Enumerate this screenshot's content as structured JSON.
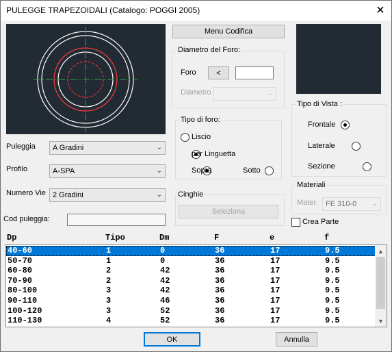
{
  "window": {
    "title": "PULEGGE TRAPEZOIDALI (Catalogo: POGGI 2005)",
    "close_glyph": "✕"
  },
  "buttons": {
    "menu_codifica": "Menu Codifica",
    "foro_arrow": "<",
    "seleziona": "Seleziona",
    "ok": "OK",
    "annulla": "Annulla"
  },
  "diametro_foro": {
    "title": "Diametro del Foro:",
    "foro_label": "Foro",
    "foro_value": "",
    "diametro_label": "Diametro",
    "diametro_value": ""
  },
  "tipo_foro": {
    "title": "Tipo di foro:",
    "liscio": "Liscio",
    "linguetta": "per Linguetta",
    "sopra": "Sopra",
    "sotto": "Sotto"
  },
  "cinghie": {
    "title": "Cinghie"
  },
  "tipo_vista": {
    "title": "Tipo di Vista :",
    "frontale": "Frontale",
    "laterale": "Laterale",
    "sezione": "Sezione"
  },
  "materiali": {
    "title": "Materiali",
    "mater_label": "Mater.",
    "mater_value": "FE 310-0"
  },
  "crea_parte": "Crea Parte",
  "fields": {
    "puleggia_label": "Puleggia",
    "puleggia_value": "A Gradini",
    "profilo_label": "Profilo",
    "profilo_value": "A-SPA",
    "numero_vie_label": "Numero Vie",
    "numero_vie_value": "2 Gradini",
    "cod_puleggia_label": "Cod puleggia:",
    "cod_puleggia_value": ""
  },
  "table": {
    "headers": [
      "Dp",
      "Tipo",
      "Dm",
      "F",
      "e",
      "f"
    ],
    "rows": [
      [
        "40-60",
        "1",
        "0",
        "36",
        "17",
        "9.5"
      ],
      [
        "50-70",
        "1",
        "0",
        "36",
        "17",
        "9.5"
      ],
      [
        "60-80",
        "2",
        "42",
        "36",
        "17",
        "9.5"
      ],
      [
        "70-90",
        "2",
        "42",
        "36",
        "17",
        "9.5"
      ],
      [
        "80-100",
        "3",
        "42",
        "36",
        "17",
        "9.5"
      ],
      [
        "90-110",
        "3",
        "46",
        "36",
        "17",
        "9.5"
      ],
      [
        "100-120",
        "3",
        "52",
        "36",
        "17",
        "9.5"
      ],
      [
        "110-130",
        "4",
        "52",
        "36",
        "17",
        "9.5"
      ]
    ]
  },
  "colors": {
    "preview_bg": "#222b33",
    "selection": "#0078d7",
    "circle_outer": "#ffffff",
    "circle_red": "#ff3b3b",
    "crosshair": "#2ea043"
  }
}
